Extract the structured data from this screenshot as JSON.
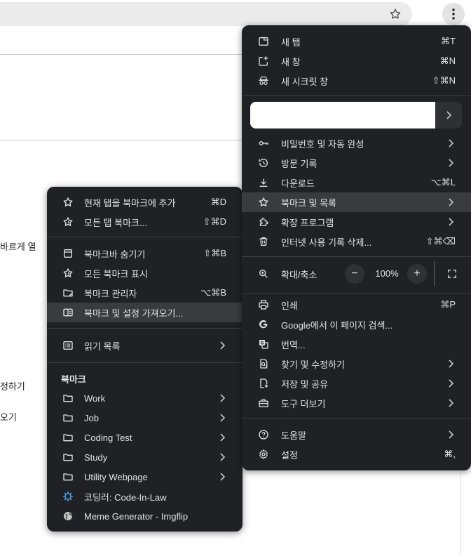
{
  "background": {
    "snippets": [
      "바르게 열",
      "정하기",
      "오기"
    ]
  },
  "main_menu": {
    "group1": [
      {
        "label": "새 탭",
        "shortcut": "⌘T",
        "icon": "new-tab-icon"
      },
      {
        "label": "새 창",
        "shortcut": "⌘N",
        "icon": "new-window-icon"
      },
      {
        "label": "새 시크릿 창",
        "shortcut": "⇧⌘N",
        "icon": "incognito-icon"
      }
    ],
    "group2": [
      {
        "label": "비밀번호 및 자동 완성",
        "icon": "key-icon",
        "submenu": true
      },
      {
        "label": "방문 기록",
        "icon": "history-icon",
        "submenu": true
      },
      {
        "label": "다운로드",
        "shortcut": "⌥⌘L",
        "icon": "download-icon"
      },
      {
        "label": "북마크 및 목록",
        "icon": "star-icon",
        "submenu": true,
        "highlighted": true
      },
      {
        "label": "확장 프로그램",
        "icon": "extension-icon",
        "submenu": true
      },
      {
        "label": "인터넷 사용 기록 삭제...",
        "shortcut": "⇧⌘⌫",
        "icon": "trash-icon"
      }
    ],
    "zoom": {
      "label": "확대/축소",
      "value": "100%",
      "minus": "−",
      "plus": "+"
    },
    "group3": [
      {
        "label": "인쇄",
        "shortcut": "⌘P",
        "icon": "print-icon"
      },
      {
        "label": "Google에서 이 페이지 검색...",
        "icon": "google-icon"
      },
      {
        "label": "번역...",
        "icon": "translate-icon"
      },
      {
        "label": "찾기 및 수정하기",
        "icon": "find-icon",
        "submenu": true
      },
      {
        "label": "저장 및 공유",
        "icon": "save-share-icon",
        "submenu": true
      },
      {
        "label": "도구 더보기",
        "icon": "toolbox-icon",
        "submenu": true
      }
    ],
    "group4": [
      {
        "label": "도움말",
        "icon": "help-icon",
        "submenu": true
      },
      {
        "label": "설정",
        "shortcut": "⌘,",
        "icon": "settings-icon"
      }
    ]
  },
  "bookmarks_menu": {
    "group1": [
      {
        "label": "현재 탭을 북마크에 추가",
        "shortcut": "⌘D",
        "icon": "star-icon"
      },
      {
        "label": "모든 탭 북마크...",
        "shortcut": "⇧⌘D",
        "icon": "star-all-icon"
      }
    ],
    "group2": [
      {
        "label": "북마크바 숨기기",
        "shortcut": "⇧⌘B",
        "icon": "bookmark-bar-icon"
      },
      {
        "label": "모든 북마크 표시",
        "icon": "star-all-icon"
      },
      {
        "label": "북마크 관리자",
        "shortcut": "⌥⌘B",
        "icon": "folder-manage-icon"
      },
      {
        "label": "북마크 및 설정 가져오기...",
        "icon": "import-icon",
        "highlighted": true
      }
    ],
    "group3": [
      {
        "label": "읽기 목록",
        "icon": "reading-list-icon",
        "submenu": true
      }
    ],
    "heading": "북마크",
    "bookmarks": [
      {
        "label": "Work",
        "icon": "folder-icon",
        "submenu": true
      },
      {
        "label": "Job",
        "icon": "folder-icon",
        "submenu": true
      },
      {
        "label": "Coding Test",
        "icon": "folder-icon",
        "submenu": true
      },
      {
        "label": "Study",
        "icon": "folder-icon",
        "submenu": true
      },
      {
        "label": "Utility Webpage",
        "icon": "folder-icon",
        "submenu": true
      },
      {
        "label": "코딩러: Code-In-Law",
        "icon": "gear-favicon-icon"
      },
      {
        "label": "Meme Generator - Imgflip",
        "icon": "globe-icon"
      }
    ]
  }
}
